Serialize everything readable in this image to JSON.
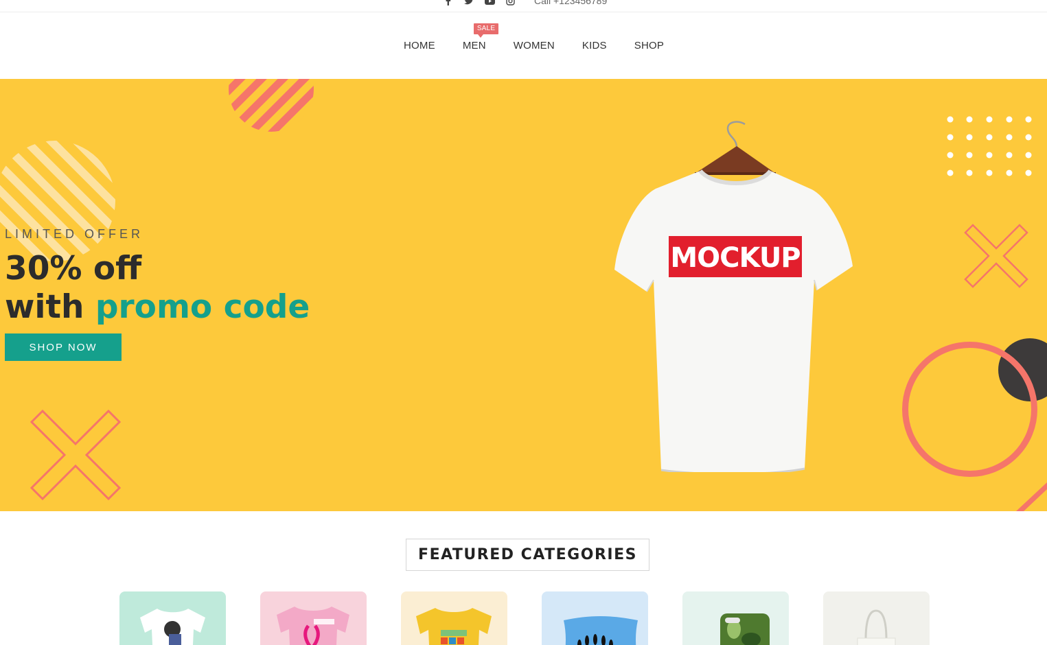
{
  "topbar": {
    "socials": [
      "facebook-icon",
      "twitter-icon",
      "youtube-icon",
      "instagram-icon"
    ],
    "phone": "Call +123456789"
  },
  "nav": {
    "items": [
      {
        "label": "HOME"
      },
      {
        "label": "MEN",
        "badge": "SALE"
      },
      {
        "label": "WOMEN"
      },
      {
        "label": "KIDS"
      },
      {
        "label": "SHOP"
      }
    ]
  },
  "hero": {
    "eyebrow": "LIMITED OFFER",
    "headline_line1": "30% off",
    "headline_line2_plain": "with",
    "headline_line2_accent": "promo code",
    "cta_label": "SHOP NOW",
    "mockup_text": "MOCKUP",
    "colors": {
      "background": "#fdc93b",
      "accent": "#15a08c",
      "coral": "#f5756a",
      "dark": "#3d3a3a"
    }
  },
  "featured": {
    "title": "FEATURED CATEGORIES",
    "cards": [
      {
        "name": "tshirt-cat",
        "bg": "#bfeadb"
      },
      {
        "name": "fight-shirt-cat",
        "bg": "#f8d3dc"
      },
      {
        "name": "yellow-tee-cat",
        "bg": "#fbeed3"
      },
      {
        "name": "pillow-cat",
        "bg": "#d5e8f8"
      },
      {
        "name": "phone-case-cat",
        "bg": "#e5f3ee"
      },
      {
        "name": "tote-bag-cat",
        "bg": "#f1f1ec"
      }
    ]
  }
}
